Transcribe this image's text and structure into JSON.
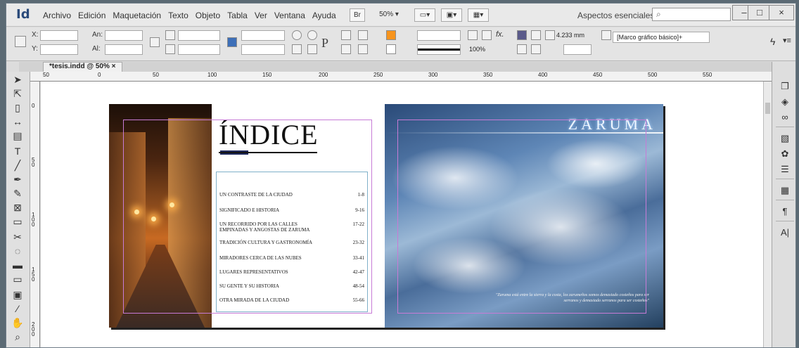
{
  "app": {
    "logo": "Id"
  },
  "menu": [
    "Archivo",
    "Edición",
    "Maquetación",
    "Texto",
    "Objeto",
    "Tabla",
    "Ver",
    "Ventana",
    "Ayuda"
  ],
  "menubar": {
    "bridge": "Br",
    "zoom": "50%",
    "workspace": "Aspectos esenciales ▾",
    "search_placeholder": ""
  },
  "window": {
    "minimize": "–",
    "maximize": "□",
    "close": "×"
  },
  "control": {
    "x_label": "X:",
    "y_label": "Y:",
    "w_label": "An:",
    "h_label": "Al:",
    "stroke_weight": "4.233 mm",
    "object_style": "[Marco gráfico básico]+",
    "scale": "100%"
  },
  "document": {
    "tab": "*tesis.indd @ 50% ×"
  },
  "ruler": {
    "h_ticks": [
      "50",
      "0",
      "50",
      "100",
      "150",
      "200",
      "250",
      "300",
      "350",
      "400",
      "450",
      "500",
      "550"
    ],
    "v_ticks": [
      "0",
      "5 0",
      "1 0 0",
      "1 5 0",
      "2 0 0"
    ]
  },
  "page_left": {
    "title": "ÍNDICE",
    "toc": [
      {
        "title": "UN CONTRASTE DE LA CIUDAD",
        "pages": "1-8"
      },
      {
        "title": "SIGNIFICADO E HISTORIA",
        "pages": "9-16"
      },
      {
        "title": "UN RECORRIDO POR LAS CALLES EMPINADAS Y ANGOSTAS DE ZARUMA",
        "pages": "17-22"
      },
      {
        "title": "TRADICIÓN CULTURA Y GASTRONOMÍA",
        "pages": "23-32"
      },
      {
        "title": "MIRADORES CERCA DE LAS NUBES",
        "pages": "33-41"
      },
      {
        "title": "LUGARES REPRESENTATIVOS",
        "pages": "42-47"
      },
      {
        "title": "SU GENTE Y SU HISTORIA",
        "pages": "48-54"
      },
      {
        "title": "OTRA MIRADA DE LA CIUDAD",
        "pages": "55-66"
      }
    ]
  },
  "page_right": {
    "title": "ZARUMA",
    "quote": "\"Zaruma está entre la sierra y la costa, los zarumeños somos demasiado costeños para ser serranos y demasiado serranos para ser costeños\""
  }
}
